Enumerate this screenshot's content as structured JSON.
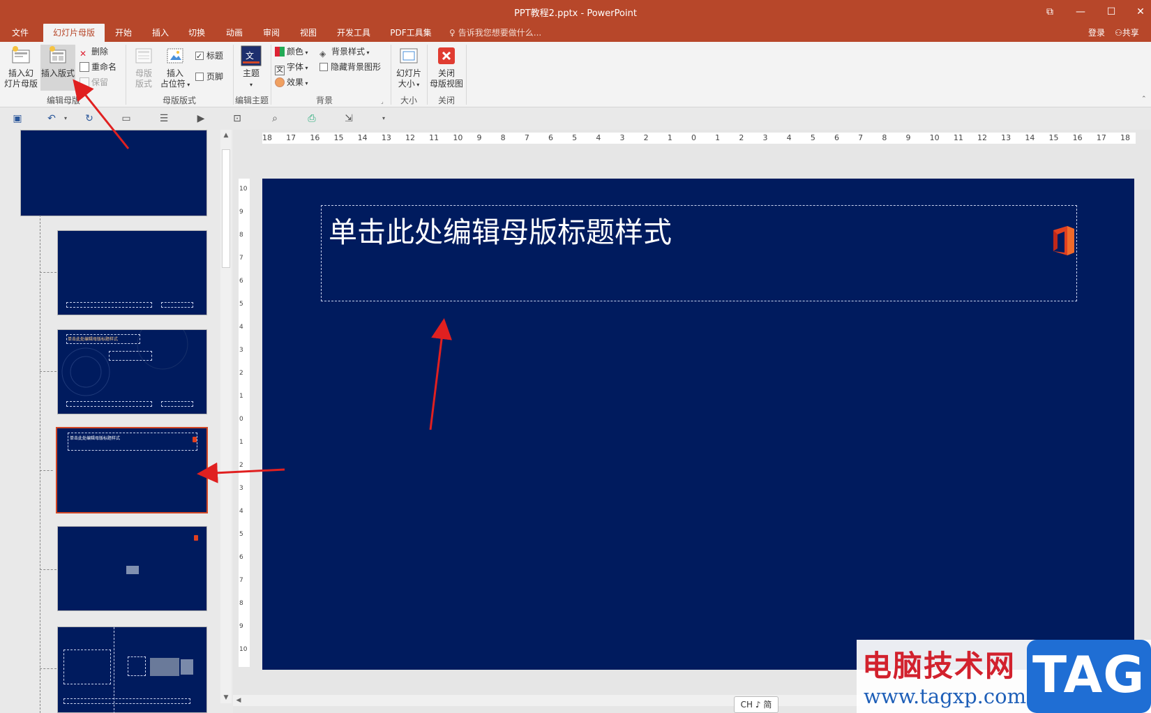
{
  "window": {
    "title": "PPT教程2.pptx - PowerPoint",
    "controls": {
      "restore": "⧉",
      "minimize": "—",
      "maximize": "☐",
      "close": "✕"
    }
  },
  "tabs": [
    {
      "label": "文件"
    },
    {
      "label": "幻灯片母版",
      "active": true
    },
    {
      "label": "开始"
    },
    {
      "label": "插入"
    },
    {
      "label": "切换"
    },
    {
      "label": "动画"
    },
    {
      "label": "审阅"
    },
    {
      "label": "视图"
    },
    {
      "label": "开发工具"
    },
    {
      "label": "PDF工具集"
    }
  ],
  "tell_me": "告诉我您想要做什么...",
  "account": {
    "login": "登录",
    "share": "共享"
  },
  "ribbon": {
    "edit_master": {
      "label": "编辑母版",
      "insert_slide_master": "插入幻灯片母版",
      "insert_slide_master_l1": "插入幻",
      "insert_slide_master_l2": "灯片母版",
      "insert_layout": "插入版式",
      "delete": "删除",
      "rename": "重命名",
      "preserve": "保留"
    },
    "master_layout": {
      "label": "母版版式",
      "master_layout_l1": "母版",
      "master_layout_l2": "版式",
      "insert_placeholder_l1": "插入",
      "insert_placeholder_l2": "占位符",
      "title_check": "标题",
      "title_checked": true,
      "footer_check": "页脚",
      "footer_checked": false
    },
    "edit_theme": {
      "label": "编辑主题",
      "themes": "主题"
    },
    "background": {
      "label": "背景",
      "colors": "颜色",
      "fonts": "字体",
      "effects": "效果",
      "bg_styles": "背景样式",
      "hide_bg_graphics": "隐藏背景图形"
    },
    "size": {
      "label": "大小",
      "slide_size_l1": "幻灯片",
      "slide_size_l2": "大小"
    },
    "close": {
      "label": "关闭",
      "close_master_l1": "关闭",
      "close_master_l2": "母版视图"
    }
  },
  "thumbnails": {
    "thumb3_title": "单击此处编辑母版标题样式",
    "thumb4_title": "单击此处编辑母版标题样式"
  },
  "rulers": {
    "horizontal": [
      "18",
      "17",
      "16",
      "15",
      "14",
      "13",
      "12",
      "11",
      "10",
      "9",
      "8",
      "7",
      "6",
      "5",
      "4",
      "3",
      "2",
      "1",
      "0",
      "1",
      "2",
      "3",
      "4",
      "5",
      "6",
      "7",
      "8",
      "9",
      "10",
      "11",
      "12",
      "13",
      "14",
      "15",
      "16",
      "17",
      "18"
    ],
    "vertical": [
      "10",
      "9",
      "8",
      "7",
      "6",
      "5",
      "4",
      "3",
      "2",
      "1",
      "0",
      "1",
      "2",
      "3",
      "4",
      "5",
      "6",
      "7",
      "8",
      "9",
      "10"
    ]
  },
  "slide": {
    "title_placeholder": "单击此处编辑母版标题样式",
    "background_color": "#001b5e"
  },
  "status": {
    "ime": "CH ♪ 简"
  },
  "watermark": {
    "site_name": "电脑技术网",
    "url": "www.tagxp.com",
    "tag": "TAG"
  },
  "colors": {
    "accent": "#b7472a",
    "selection": "#d24726",
    "slide_bg": "#001b5e",
    "annotation_arrow": "#e02020"
  }
}
